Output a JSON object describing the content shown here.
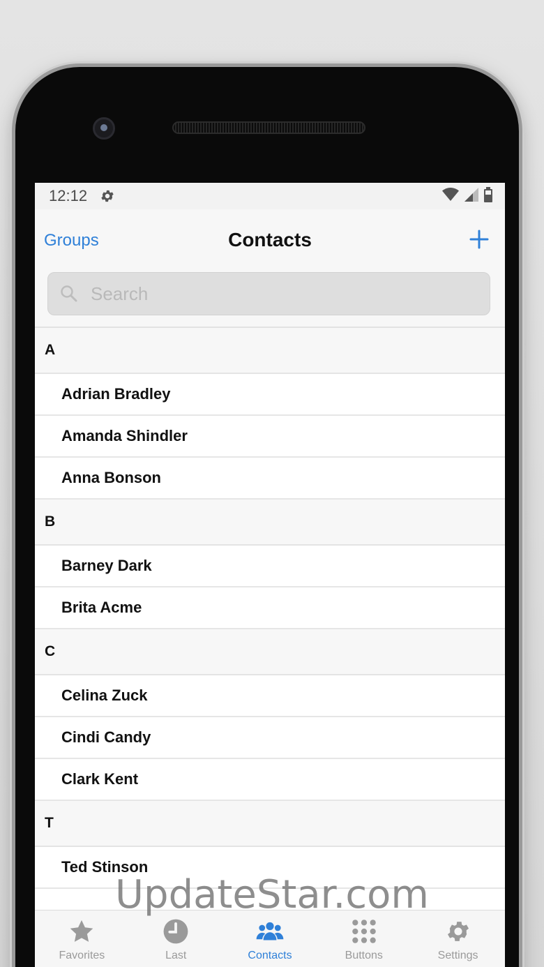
{
  "status_bar": {
    "time": "12:12"
  },
  "nav": {
    "left_label": "Groups",
    "title": "Contacts"
  },
  "search": {
    "placeholder": "Search"
  },
  "sections": [
    {
      "letter": "A",
      "contacts": [
        "Adrian Bradley",
        "Amanda Shindler",
        "Anna Bonson"
      ]
    },
    {
      "letter": "B",
      "contacts": [
        "Barney Dark",
        "Brita Acme"
      ]
    },
    {
      "letter": "C",
      "contacts": [
        "Celina Zuck",
        "Cindi Candy",
        "Clark Kent"
      ]
    },
    {
      "letter": "T",
      "contacts": [
        "Ted Stinson"
      ]
    }
  ],
  "tabs": [
    {
      "label": "Favorites",
      "icon": "star-icon",
      "active": false
    },
    {
      "label": "Last",
      "icon": "clock-icon",
      "active": false
    },
    {
      "label": "Contacts",
      "icon": "people-icon",
      "active": true
    },
    {
      "label": "Buttons",
      "icon": "grid-dots-icon",
      "active": false
    },
    {
      "label": "Settings",
      "icon": "gear-icon",
      "active": false
    }
  ],
  "watermark": "UpdateStar.com",
  "colors": {
    "accent": "#2f80d8",
    "inactive": "#9a9a9a"
  }
}
